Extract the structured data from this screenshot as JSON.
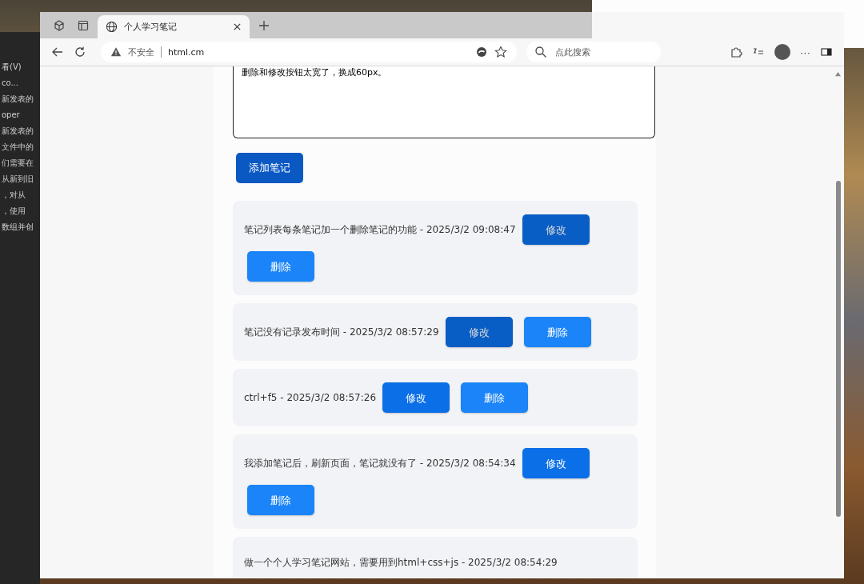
{
  "background_editor": {
    "lines": [
      "看(V)",
      "co...",
      "新发表的",
      "oper",
      "新发表的",
      "文件中的",
      "们需要在",
      "从新到旧",
      "，对从",
      "，使用",
      "数组并创"
    ]
  },
  "browser": {
    "tabs": [
      {
        "title": "个人学习笔记",
        "selected": true
      }
    ],
    "address": {
      "security": "不安全",
      "url": "html.cm"
    },
    "search": {
      "placeholder": "点此搜索"
    },
    "more_label": "···",
    "page": {
      "note_input": {
        "value": "删除和修改按钮太宽了，换成60px。"
      },
      "add_button": {
        "label": "添加笔记",
        "hovered": true
      },
      "notes": [
        {
          "text": "笔记列表每条笔记加一个删除笔记的功能 - 2025/3/2 09:08:47",
          "buttons": [
            {
              "kind": "edit",
              "label": "修改",
              "hovered": true
            },
            {
              "kind": "delete",
              "label": "删除",
              "hovered": false
            }
          ]
        },
        {
          "text": "笔记没有记录发布时间 - 2025/3/2 08:57:29",
          "buttons": [
            {
              "kind": "edit",
              "label": "修改",
              "hovered": true
            },
            {
              "kind": "delete",
              "label": "删除",
              "hovered": false
            }
          ]
        },
        {
          "text": "ctrl+f5 - 2025/3/2 08:57:26",
          "buttons": [
            {
              "kind": "edit",
              "label": "修改",
              "hovered": false
            },
            {
              "kind": "delete",
              "label": "删除",
              "hovered": false
            }
          ]
        },
        {
          "text": "我添加笔记后，刷新页面，笔记就没有了 - 2025/3/2 08:54:34",
          "buttons": [
            {
              "kind": "edit",
              "label": "修改",
              "hovered": false
            },
            {
              "kind": "delete",
              "label": "删除",
              "hovered": false
            }
          ]
        },
        {
          "text": "做一个个人学习笔记网站，需要用到html+css+js - 2025/3/2 08:54:29"
        }
      ]
    }
  }
}
